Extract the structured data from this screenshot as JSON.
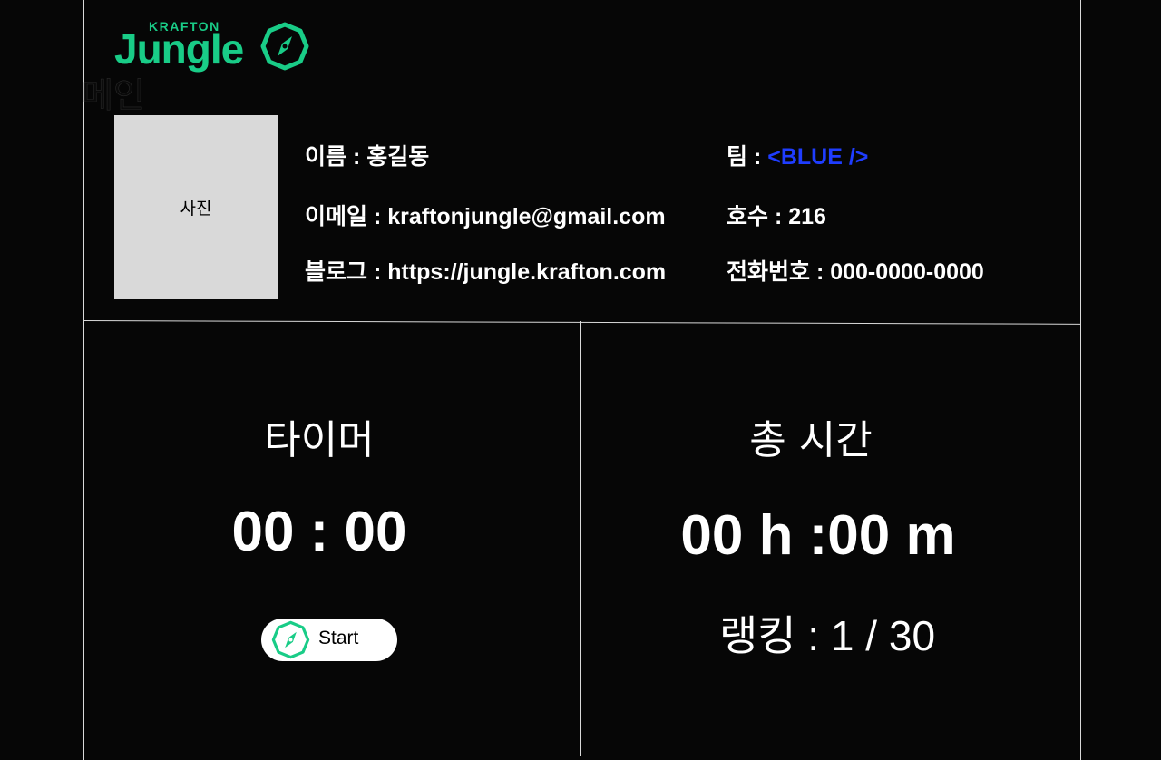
{
  "header": {
    "logo_top": "KRAFTON",
    "logo_main": "Jungle",
    "faded_title": "메인"
  },
  "profile": {
    "photo_label": "사진",
    "name_line": "이름 : 홍길동",
    "email_line": "이메일 : kraftonjungle@gmail.com",
    "blog_line": "블로그 : https://jungle.krafton.com",
    "team_label": "팀 : ",
    "team_value": "<BLUE />",
    "room_line": "호수 : 216",
    "phone_line": "전화번호 : 000-0000-0000"
  },
  "timer": {
    "title": "타이머",
    "value": "00 : 00",
    "start_label": "Start"
  },
  "total": {
    "title": "총 시간",
    "value": "00 h :00 m",
    "ranking": "랭킹 : 1 / 30"
  },
  "colors": {
    "brand": "#19cc87",
    "team": "#1f3dff",
    "background": "#060606",
    "photo_bg": "#d9d9d9"
  }
}
